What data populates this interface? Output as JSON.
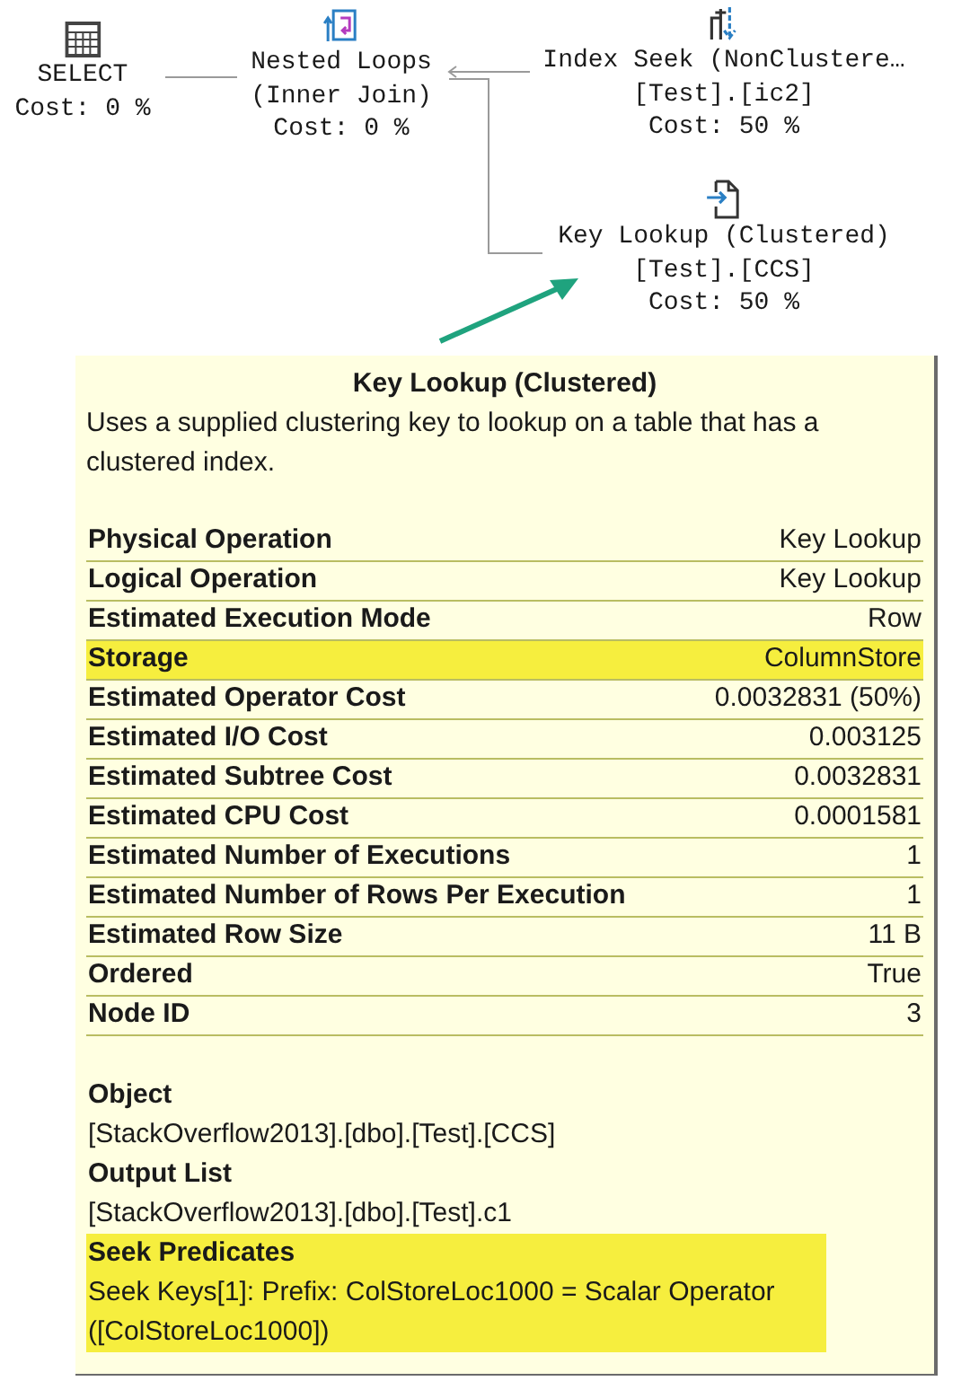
{
  "plan": {
    "nodes": [
      {
        "kind": "select",
        "lines": [
          "SELECT",
          "Cost: 0 %"
        ]
      },
      {
        "kind": "nested_loops",
        "lines": [
          "Nested Loops",
          "(Inner Join)",
          "Cost: 0 %"
        ]
      },
      {
        "kind": "index_seek",
        "lines": [
          "Index Seek (NonClustere…",
          "[Test].[ic2]",
          "Cost: 50 %"
        ]
      },
      {
        "kind": "key_lookup",
        "lines": [
          "Key Lookup (Clustered)",
          "[Test].[CCS]",
          "Cost: 50 %"
        ]
      }
    ]
  },
  "tooltip": {
    "title": "Key Lookup (Clustered)",
    "description": "Uses a supplied clustering key to lookup on a table that has a clustered index.",
    "properties": [
      {
        "label": "Physical Operation",
        "value": "Key Lookup",
        "highlighted": false
      },
      {
        "label": "Logical Operation",
        "value": "Key Lookup",
        "highlighted": false
      },
      {
        "label": "Estimated Execution Mode",
        "value": "Row",
        "highlighted": false
      },
      {
        "label": "Storage",
        "value": "ColumnStore",
        "highlighted": true
      },
      {
        "label": "Estimated Operator Cost",
        "value": "0.0032831 (50%)",
        "highlighted": false
      },
      {
        "label": "Estimated I/O Cost",
        "value": "0.003125",
        "highlighted": false
      },
      {
        "label": "Estimated Subtree Cost",
        "value": "0.0032831",
        "highlighted": false
      },
      {
        "label": "Estimated CPU Cost",
        "value": "0.0001581",
        "highlighted": false
      },
      {
        "label": "Estimated Number of Executions",
        "value": "1",
        "highlighted": false
      },
      {
        "label": "Estimated Number of Rows Per Execution",
        "value": "1",
        "highlighted": false
      },
      {
        "label": "Estimated Row Size",
        "value": "11 B",
        "highlighted": false
      },
      {
        "label": "Ordered",
        "value": "True",
        "highlighted": false
      },
      {
        "label": "Node ID",
        "value": "3",
        "highlighted": false
      }
    ],
    "sections": [
      {
        "label": "Object",
        "value": "[StackOverflow2013].[dbo].[Test].[CCS]",
        "highlighted": false
      },
      {
        "label": "Output List",
        "value": "[StackOverflow2013].[dbo].[Test].c1",
        "highlighted": false
      },
      {
        "label": "Seek Predicates",
        "value": "Seek Keys[1]: Prefix: ColStoreLoc1000 = Scalar Operator ([ColStoreLoc1000])",
        "highlighted": true
      }
    ]
  }
}
